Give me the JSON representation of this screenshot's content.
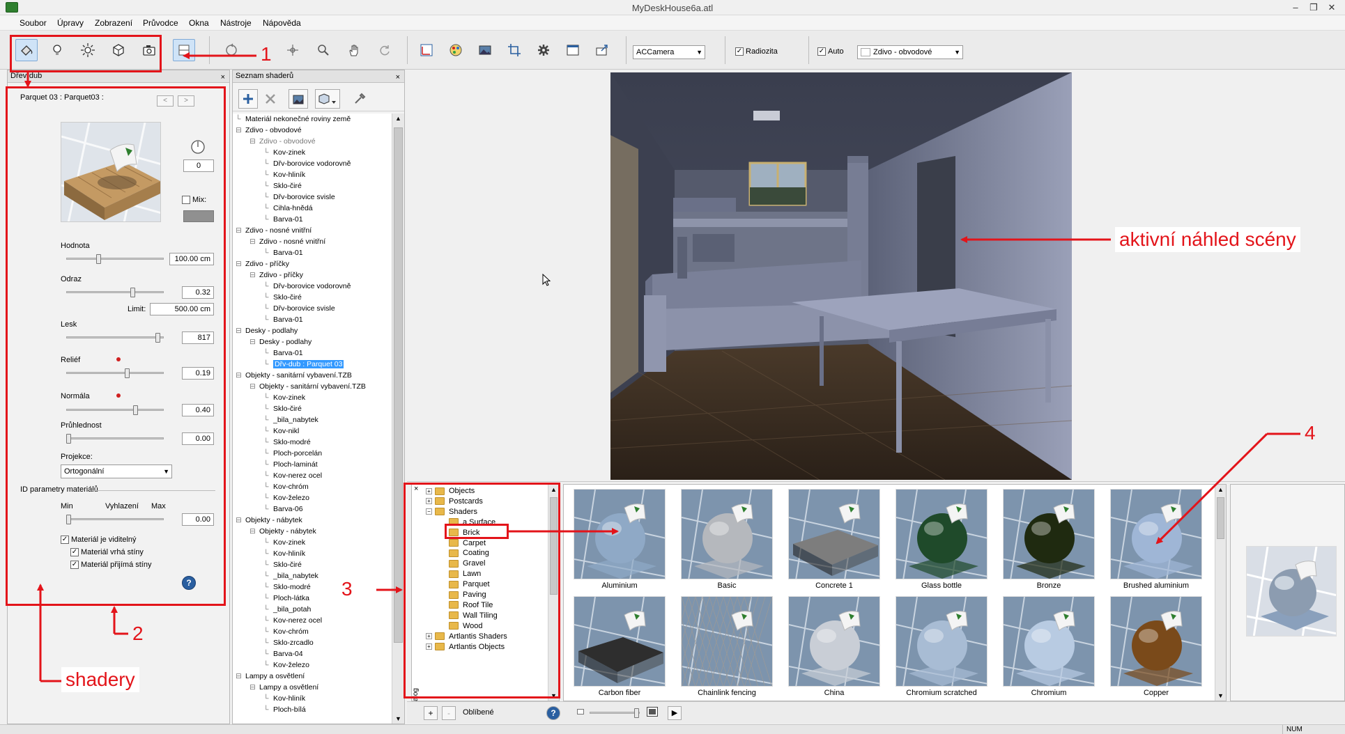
{
  "window": {
    "title": "MyDeskHouse6a.atl"
  },
  "menu": [
    "Soubor",
    "Úpravy",
    "Zobrazení",
    "Průvodce",
    "Okna",
    "Nástroje",
    "Nápověda"
  ],
  "toolbar": {
    "camera_select": "ACCamera",
    "radiosity_label": "Radiozita",
    "auto_label": "Auto",
    "material_select": "Zdivo - obvodové"
  },
  "left_panel": {
    "title": "Dřev-dub",
    "material_name": "Parquet 03 : Parquet03 :",
    "nav_prev": "<",
    "nav_next": ">",
    "rotation_value": "0",
    "mix_label": "Mix:",
    "hodnota_label": "Hodnota",
    "hodnota_value": "100.00 cm",
    "odraz_label": "Odraz",
    "odraz_value": "0.32",
    "limit_label": "Limit:",
    "limit_value": "500.00 cm",
    "lesk_label": "Lesk",
    "lesk_value": "817",
    "relief_label": "Reliéf",
    "relief_value": "0.19",
    "normala_label": "Normála",
    "normala_value": "0.40",
    "pruhlednost_label": "Průhlednost",
    "pruhlednost_value": "0.00",
    "projekce_label": "Projekce:",
    "projekce_value": "Ortogonální",
    "id_params_label": "ID parametry materiálů",
    "min_label": "Min",
    "vyhlazeni_label": "Vyhlazení",
    "max_label": "Max",
    "vyhlazeni_value": "0.00",
    "check_visible": "Materiál je viditelný",
    "check_casts": "Materiál vrhá stíny",
    "check_receives": "Materiál přijímá stíny",
    "help": "?"
  },
  "shader_list": {
    "title": "Seznam shaderů",
    "rows": [
      {
        "text": "Materiál nekonečné roviny země",
        "level": 0,
        "exp": ""
      },
      {
        "text": "Zdivo - obvodové",
        "level": 0,
        "exp": "⊟"
      },
      {
        "text": "Zdivo - obvodové",
        "level": 1,
        "exp": "⊟",
        "grey": true
      },
      {
        "text": "Kov-zinek",
        "level": 2,
        "exp": ""
      },
      {
        "text": "Dřv-borovice vodorovně",
        "level": 2,
        "exp": ""
      },
      {
        "text": "Kov-hliník",
        "level": 2,
        "exp": ""
      },
      {
        "text": "Sklo-čiré",
        "level": 2,
        "exp": ""
      },
      {
        "text": "Dřv-borovice svisle",
        "level": 2,
        "exp": ""
      },
      {
        "text": "Cihla-hnědá",
        "level": 2,
        "exp": ""
      },
      {
        "text": "Barva-01",
        "level": 2,
        "exp": ""
      },
      {
        "text": "Zdivo - nosné vnitřní",
        "level": 0,
        "exp": "⊟"
      },
      {
        "text": "Zdivo - nosné vnitřní",
        "level": 1,
        "exp": "⊟"
      },
      {
        "text": "Barva-01",
        "level": 2,
        "exp": ""
      },
      {
        "text": "Zdivo - příčky",
        "level": 0,
        "exp": "⊟"
      },
      {
        "text": "Zdivo - příčky",
        "level": 1,
        "exp": "⊟"
      },
      {
        "text": "Dřv-borovice vodorovně",
        "level": 2,
        "exp": ""
      },
      {
        "text": "Sklo-čiré",
        "level": 2,
        "exp": ""
      },
      {
        "text": "Dřv-borovice svisle",
        "level": 2,
        "exp": ""
      },
      {
        "text": "Barva-01",
        "level": 2,
        "exp": ""
      },
      {
        "text": "Desky - podlahy",
        "level": 0,
        "exp": "⊟"
      },
      {
        "text": "Desky - podlahy",
        "level": 1,
        "exp": "⊟"
      },
      {
        "text": "Barva-01",
        "level": 2,
        "exp": ""
      },
      {
        "text": "Dřv-dub : Parquet 03",
        "level": 2,
        "exp": "",
        "selected": true
      },
      {
        "text": "Objekty - sanitární vybavení.TZB",
        "level": 0,
        "exp": "⊟"
      },
      {
        "text": "Objekty - sanitární vybavení.TZB",
        "level": 1,
        "exp": "⊟"
      },
      {
        "text": "Kov-zinek",
        "level": 2,
        "exp": ""
      },
      {
        "text": "Sklo-čiré",
        "level": 2,
        "exp": ""
      },
      {
        "text": "_bila_nabytek",
        "level": 2,
        "exp": ""
      },
      {
        "text": "Kov-nikl",
        "level": 2,
        "exp": ""
      },
      {
        "text": "Sklo-modré",
        "level": 2,
        "exp": ""
      },
      {
        "text": "Ploch-porcelán",
        "level": 2,
        "exp": ""
      },
      {
        "text": "Ploch-laminát",
        "level": 2,
        "exp": ""
      },
      {
        "text": "Kov-nerez ocel",
        "level": 2,
        "exp": ""
      },
      {
        "text": "Kov-chróm",
        "level": 2,
        "exp": ""
      },
      {
        "text": "Kov-železo",
        "level": 2,
        "exp": ""
      },
      {
        "text": "Barva-06",
        "level": 2,
        "exp": ""
      },
      {
        "text": "Objekty - nábytek",
        "level": 0,
        "exp": "⊟"
      },
      {
        "text": "Objekty - nábytek",
        "level": 1,
        "exp": "⊟"
      },
      {
        "text": "Kov-zinek",
        "level": 2,
        "exp": ""
      },
      {
        "text": "Kov-hliník",
        "level": 2,
        "exp": ""
      },
      {
        "text": "Sklo-čiré",
        "level": 2,
        "exp": ""
      },
      {
        "text": "_bila_nabytek",
        "level": 2,
        "exp": ""
      },
      {
        "text": "Sklo-modré",
        "level": 2,
        "exp": ""
      },
      {
        "text": "Ploch-látka",
        "level": 2,
        "exp": ""
      },
      {
        "text": "_bila_potah",
        "level": 2,
        "exp": ""
      },
      {
        "text": "Kov-nerez ocel",
        "level": 2,
        "exp": ""
      },
      {
        "text": "Kov-chróm",
        "level": 2,
        "exp": ""
      },
      {
        "text": "Sklo-zrcadlo",
        "level": 2,
        "exp": ""
      },
      {
        "text": "Barva-04",
        "level": 2,
        "exp": ""
      },
      {
        "text": "Kov-železo",
        "level": 2,
        "exp": ""
      },
      {
        "text": "Lampy a osvětlení",
        "level": 0,
        "exp": "⊟"
      },
      {
        "text": "Lampy a osvětlení",
        "level": 1,
        "exp": "⊟"
      },
      {
        "text": "Kov-hliník",
        "level": 2,
        "exp": ""
      },
      {
        "text": "Ploch-bílá",
        "level": 2,
        "exp": ""
      }
    ]
  },
  "catalog": {
    "side_label": "Katalog",
    "close": "×",
    "tree": [
      {
        "text": "Objects",
        "level": 0,
        "exp": "+"
      },
      {
        "text": "Postcards",
        "level": 0,
        "exp": "+"
      },
      {
        "text": "Shaders",
        "level": 0,
        "exp": "−"
      },
      {
        "text": "a Surface",
        "level": 1,
        "exp": "",
        "selected": true
      },
      {
        "text": "Brick",
        "level": 1,
        "exp": ""
      },
      {
        "text": "Carpet",
        "level": 1,
        "exp": ""
      },
      {
        "text": "Coating",
        "level": 1,
        "exp": ""
      },
      {
        "text": "Gravel",
        "level": 1,
        "exp": ""
      },
      {
        "text": "Lawn",
        "level": 1,
        "exp": ""
      },
      {
        "text": "Parquet",
        "level": 1,
        "exp": ""
      },
      {
        "text": "Paving",
        "level": 1,
        "exp": ""
      },
      {
        "text": "Roof Tile",
        "level": 1,
        "exp": ""
      },
      {
        "text": "Wall Tiling",
        "level": 1,
        "exp": ""
      },
      {
        "text": "Wood",
        "level": 1,
        "exp": ""
      },
      {
        "text": "Artlantis Shaders",
        "level": 0,
        "exp": "+"
      },
      {
        "text": "Artlantis Objects",
        "level": 0,
        "exp": "+"
      }
    ],
    "thumbs": [
      {
        "label": "Aluminium",
        "kind": "sphere",
        "color": "#8fa9c6"
      },
      {
        "label": "Basic",
        "kind": "sphere",
        "color": "#b5b8bd"
      },
      {
        "label": "Concrete 1",
        "kind": "slab",
        "color": "#7d7d7d"
      },
      {
        "label": "Glass bottle",
        "kind": "sphere",
        "color": "#1f4a2a"
      },
      {
        "label": "Bronze",
        "kind": "sphere",
        "color": "#1f2a10"
      },
      {
        "label": "Brushed aluminium",
        "kind": "sphere",
        "color": "#9fb6d6"
      },
      {
        "label": "Carbon fiber",
        "kind": "slab",
        "color": "#2e2e2e"
      },
      {
        "label": "Chainlink fencing",
        "kind": "mesh",
        "color": "#d8d8d8"
      },
      {
        "label": "China",
        "kind": "sphere",
        "color": "#c9ced6"
      },
      {
        "label": "Chromium scratched",
        "kind": "sphere",
        "color": "#a8bcd4"
      },
      {
        "label": "Chromium",
        "kind": "sphere",
        "color": "#b8cbe2"
      },
      {
        "label": "Copper",
        "kind": "sphere",
        "color": "#7a4a1a"
      }
    ],
    "favorites_label": "Oblíbené",
    "add": "+",
    "remove": "-",
    "help": "?"
  },
  "annotations": {
    "n1": "1",
    "n2": "2",
    "n3": "3",
    "n4": "4",
    "shadery": "shadery",
    "scene": "aktivní náhled scény"
  },
  "status": {
    "num": "NUM"
  }
}
